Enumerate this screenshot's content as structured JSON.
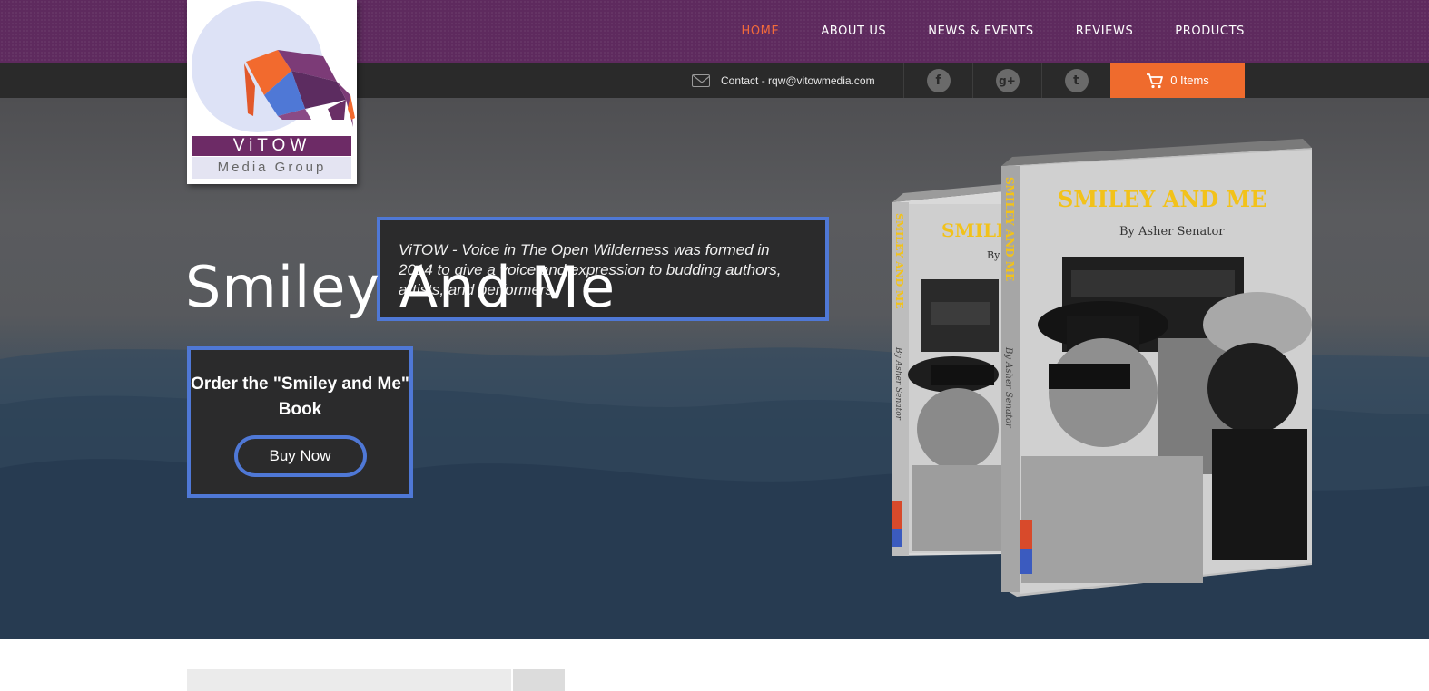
{
  "brand": {
    "name": "ViTOW",
    "tagline": "Media Group"
  },
  "nav": {
    "items": [
      {
        "label": "HOME",
        "active": true
      },
      {
        "label": "ABOUT US",
        "active": false
      },
      {
        "label": "NEWS & EVENTS",
        "active": false
      },
      {
        "label": "REVIEWS",
        "active": false
      },
      {
        "label": "PRODUCTS",
        "active": false
      }
    ]
  },
  "topbar": {
    "contact": "Contact - rqw@vitowmedia.com",
    "social": [
      {
        "icon": "facebook-icon",
        "glyph": "f"
      },
      {
        "icon": "google-plus-icon",
        "glyph": "g+"
      },
      {
        "icon": "twitter-icon",
        "glyph": "t"
      }
    ],
    "cart_label": "0 Items"
  },
  "hero": {
    "intro": "ViTOW - Voice in The Open Wilderness was formed in 2014 to give a voice and expression to budding authors, artists, and performers.",
    "headline": "Smiley And Me",
    "order_text": "Order the \"Smiley and Me\" Book",
    "buy_label": "Buy Now"
  },
  "book": {
    "title": "SMILEY AND ME",
    "author": "By Asher Senator",
    "spine_title": "SMILEY AND ME",
    "spine_author": "By Asher Senator",
    "front_partial_title": "SMILE",
    "front_partial_author": "By"
  },
  "colors": {
    "nav_bg": "#5e2a5e",
    "accent_orange": "#ef6b2d",
    "accent_blue": "#4f78d6",
    "dark_panel": "#2b2b2c"
  }
}
